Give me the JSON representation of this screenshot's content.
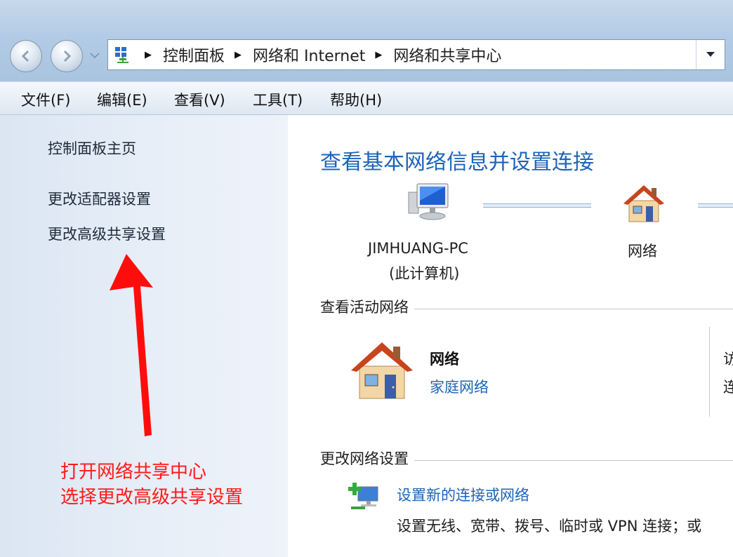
{
  "navigation": {
    "back_label": "",
    "forward_label": ""
  },
  "address_bar": {
    "crumbs": [
      "控制面板",
      "网络和 Internet",
      "网络和共享中心"
    ]
  },
  "menu": {
    "items": [
      "文件(F)",
      "编辑(E)",
      "查看(V)",
      "工具(T)",
      "帮助(H)"
    ]
  },
  "sidebar": {
    "home": "控制面板主页",
    "links": [
      "更改适配器设置",
      "更改高级共享设置"
    ]
  },
  "annotation": {
    "line1": "打开网络共享中心",
    "line2": "选择更改高级共享设置",
    "color": "#ff1a1a"
  },
  "main": {
    "title": "查看基本网络信息并设置连接",
    "map": {
      "computer_name": "JIMHUANG-PC",
      "computer_sub": "(此计算机)",
      "network_label": "网络"
    },
    "active_section": "查看活动网络",
    "active_network": {
      "name": "网络",
      "type": "家庭网络"
    },
    "cut_off_right": [
      "访",
      "连"
    ],
    "change_section": "更改网络设置",
    "task": {
      "title": "设置新的连接或网络",
      "desc": "设置无线、宽带、拨号、临时或 VPN 连接；或"
    }
  },
  "colors": {
    "link": "#1c64b8",
    "title": "#1c64b8"
  },
  "icons": {
    "address": "network-center-icon",
    "computer": "computer-icon",
    "home_network": "house-icon",
    "new_connection": "new-connection-icon"
  }
}
